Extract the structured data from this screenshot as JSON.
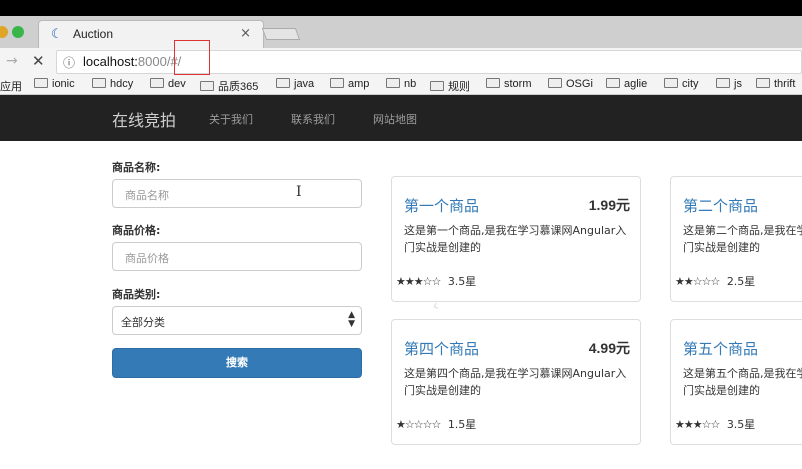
{
  "browser": {
    "tab_title": "Auction",
    "tab_close": "×",
    "url_host": "localhost:",
    "url_port": "8000",
    "url_path": "/#/",
    "bookmarks": [
      "应用",
      "ionic",
      "hdcy",
      "dev",
      "品质365",
      "java",
      "amp",
      "nb",
      "规则",
      "storm",
      "OSGi",
      "aglie",
      "city",
      "js",
      "thrift"
    ]
  },
  "navbar": {
    "brand": "在线竞拍",
    "links": [
      "关于我们",
      "联系我们",
      "网站地图"
    ]
  },
  "search_form": {
    "name_label": "商品名称:",
    "name_placeholder": "商品名称",
    "price_label": "商品价格:",
    "price_placeholder": "商品价格",
    "category_label": "商品类别:",
    "category_value": "全部分类",
    "submit_label": "搜索"
  },
  "products": [
    {
      "title": "第一个商品",
      "price": "1.99元",
      "desc": "这是第一个商品,是我在学习慕课网Angular入门实战是创建的",
      "stars": "★★★☆☆",
      "rating_text": "3.5星",
      "rating": 3.5
    },
    {
      "title": "第二个商品",
      "price": "",
      "desc": "这是第二个商品,是我在学习慕课网Angular入门实战是创建的",
      "stars": "★★☆☆☆",
      "rating_text": "2.5星",
      "rating": 2.5
    },
    {
      "title": "第四个商品",
      "price": "4.99元",
      "desc": "这是第四个商品,是我在学习慕课网Angular入门实战是创建的",
      "stars": "★☆☆☆☆",
      "rating_text": "1.5星",
      "rating": 1.5
    },
    {
      "title": "第五个商品",
      "price": "",
      "desc": "这是第五个商品,是我在学习慕课网Angular入门实战是创建的",
      "stars": "★★★☆☆",
      "rating_text": "3.5星",
      "rating": 3.5
    }
  ],
  "colors": {
    "navbar_bg": "#222222",
    "primary": "#337ab7",
    "annotation_box": "#dd3333"
  }
}
